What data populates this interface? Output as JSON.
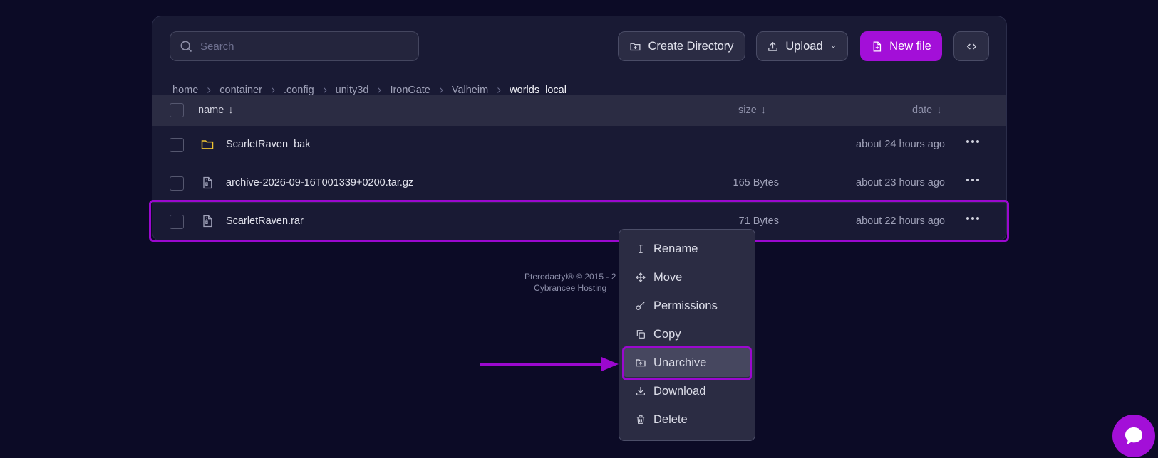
{
  "search": {
    "placeholder": "Search"
  },
  "toolbar": {
    "create_directory": "Create Directory",
    "upload": "Upload",
    "new_file": "New file"
  },
  "breadcrumb": [
    "home",
    "container",
    ".config",
    "unity3d",
    "IronGate",
    "Valheim",
    "worlds_local"
  ],
  "table": {
    "headers": {
      "name": "name",
      "size": "size",
      "date": "date"
    },
    "rows": [
      {
        "name": "ScarletRaven_bak",
        "type": "folder",
        "size": "",
        "date": "about 24 hours ago"
      },
      {
        "name": "archive-2026-09-16T001339+0200.tar.gz",
        "type": "archive",
        "size": "165 Bytes",
        "date": "about 23 hours ago"
      },
      {
        "name": "ScarletRaven.rar",
        "type": "archive",
        "size": "71 Bytes",
        "date": "about 22 hours ago"
      }
    ]
  },
  "footer": {
    "line1": "Pterodactyl® © 2015 - 2",
    "line2": "Cybrancee Hosting"
  },
  "context_menu": {
    "items": [
      {
        "label": "Rename",
        "icon": "text-cursor-icon"
      },
      {
        "label": "Move",
        "icon": "move-icon"
      },
      {
        "label": "Permissions",
        "icon": "key-icon"
      },
      {
        "label": "Copy",
        "icon": "copy-icon"
      },
      {
        "label": "Unarchive",
        "icon": "folder-unarchive-icon"
      },
      {
        "label": "Download",
        "icon": "download-icon"
      },
      {
        "label": "Delete",
        "icon": "trash-icon"
      }
    ],
    "active": "Unarchive"
  },
  "colors": {
    "background": "#0c0b26",
    "panel": "#191a34",
    "accent": "#a30fd8",
    "highlight": "#9b08cf",
    "folder": "#f0c431"
  }
}
